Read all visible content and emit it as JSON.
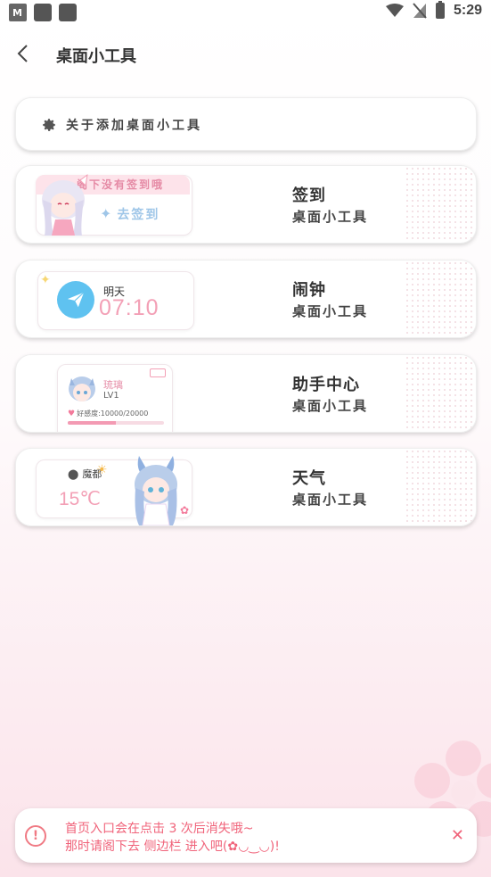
{
  "status_bar": {
    "time": "5:29"
  },
  "header": {
    "title": "桌面小工具"
  },
  "about": {
    "label": "关于添加桌面小工具"
  },
  "widgets": [
    {
      "title": "签到",
      "subtitle": "桌面小工具",
      "preview": {
        "banner": "阁下没有签到哦",
        "action": "去签到"
      }
    },
    {
      "title": "闹钟",
      "subtitle": "桌面小工具",
      "preview": {
        "day": "明天",
        "time": "07:10"
      }
    },
    {
      "title": "助手中心",
      "subtitle": "桌面小工具",
      "preview": {
        "name": "琉璃",
        "level": "LV1",
        "favor": "好感度:10000/20000",
        "favor_progress": 0.5
      }
    },
    {
      "title": "天气",
      "subtitle": "桌面小工具",
      "preview": {
        "location": "魔都",
        "temperature": "15℃"
      }
    }
  ],
  "toast": {
    "line1": "首页入口会在点击 3 次后消失哦~",
    "line2": "那时请阁下去 侧边栏 进入吧(✿◡‿◡)!"
  },
  "colors": {
    "accent_pink": "#f3a0b6",
    "accent_blue": "#5fc2f0",
    "toast_red": "#f0637a"
  }
}
